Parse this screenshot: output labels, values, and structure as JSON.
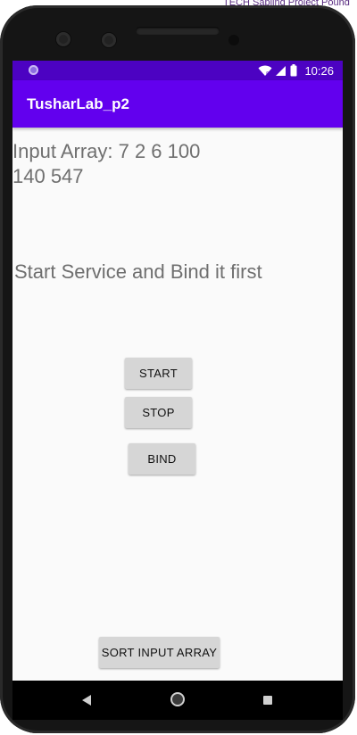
{
  "background_text": "TECH Sapling Project Pound",
  "status_bar": {
    "time": "10:26",
    "icons": [
      "notification-dot-icon",
      "wifi-icon",
      "signal-icon",
      "battery-icon"
    ]
  },
  "app_bar": {
    "title": "TusharLab_p2",
    "color": "#6200ee",
    "status_color": "#4c02c2"
  },
  "main": {
    "input_array_line1": "Input Array:  7 2 6 100",
    "input_array_line2": "140 547",
    "service_message": "Start Service and Bind it first"
  },
  "buttons": {
    "start": "START",
    "stop": "STOP",
    "bind": "BIND",
    "sort": "SORT INPUT ARRAY"
  },
  "nav_bar": {
    "icons": [
      "back-icon",
      "home-icon",
      "recent-apps-icon"
    ]
  }
}
